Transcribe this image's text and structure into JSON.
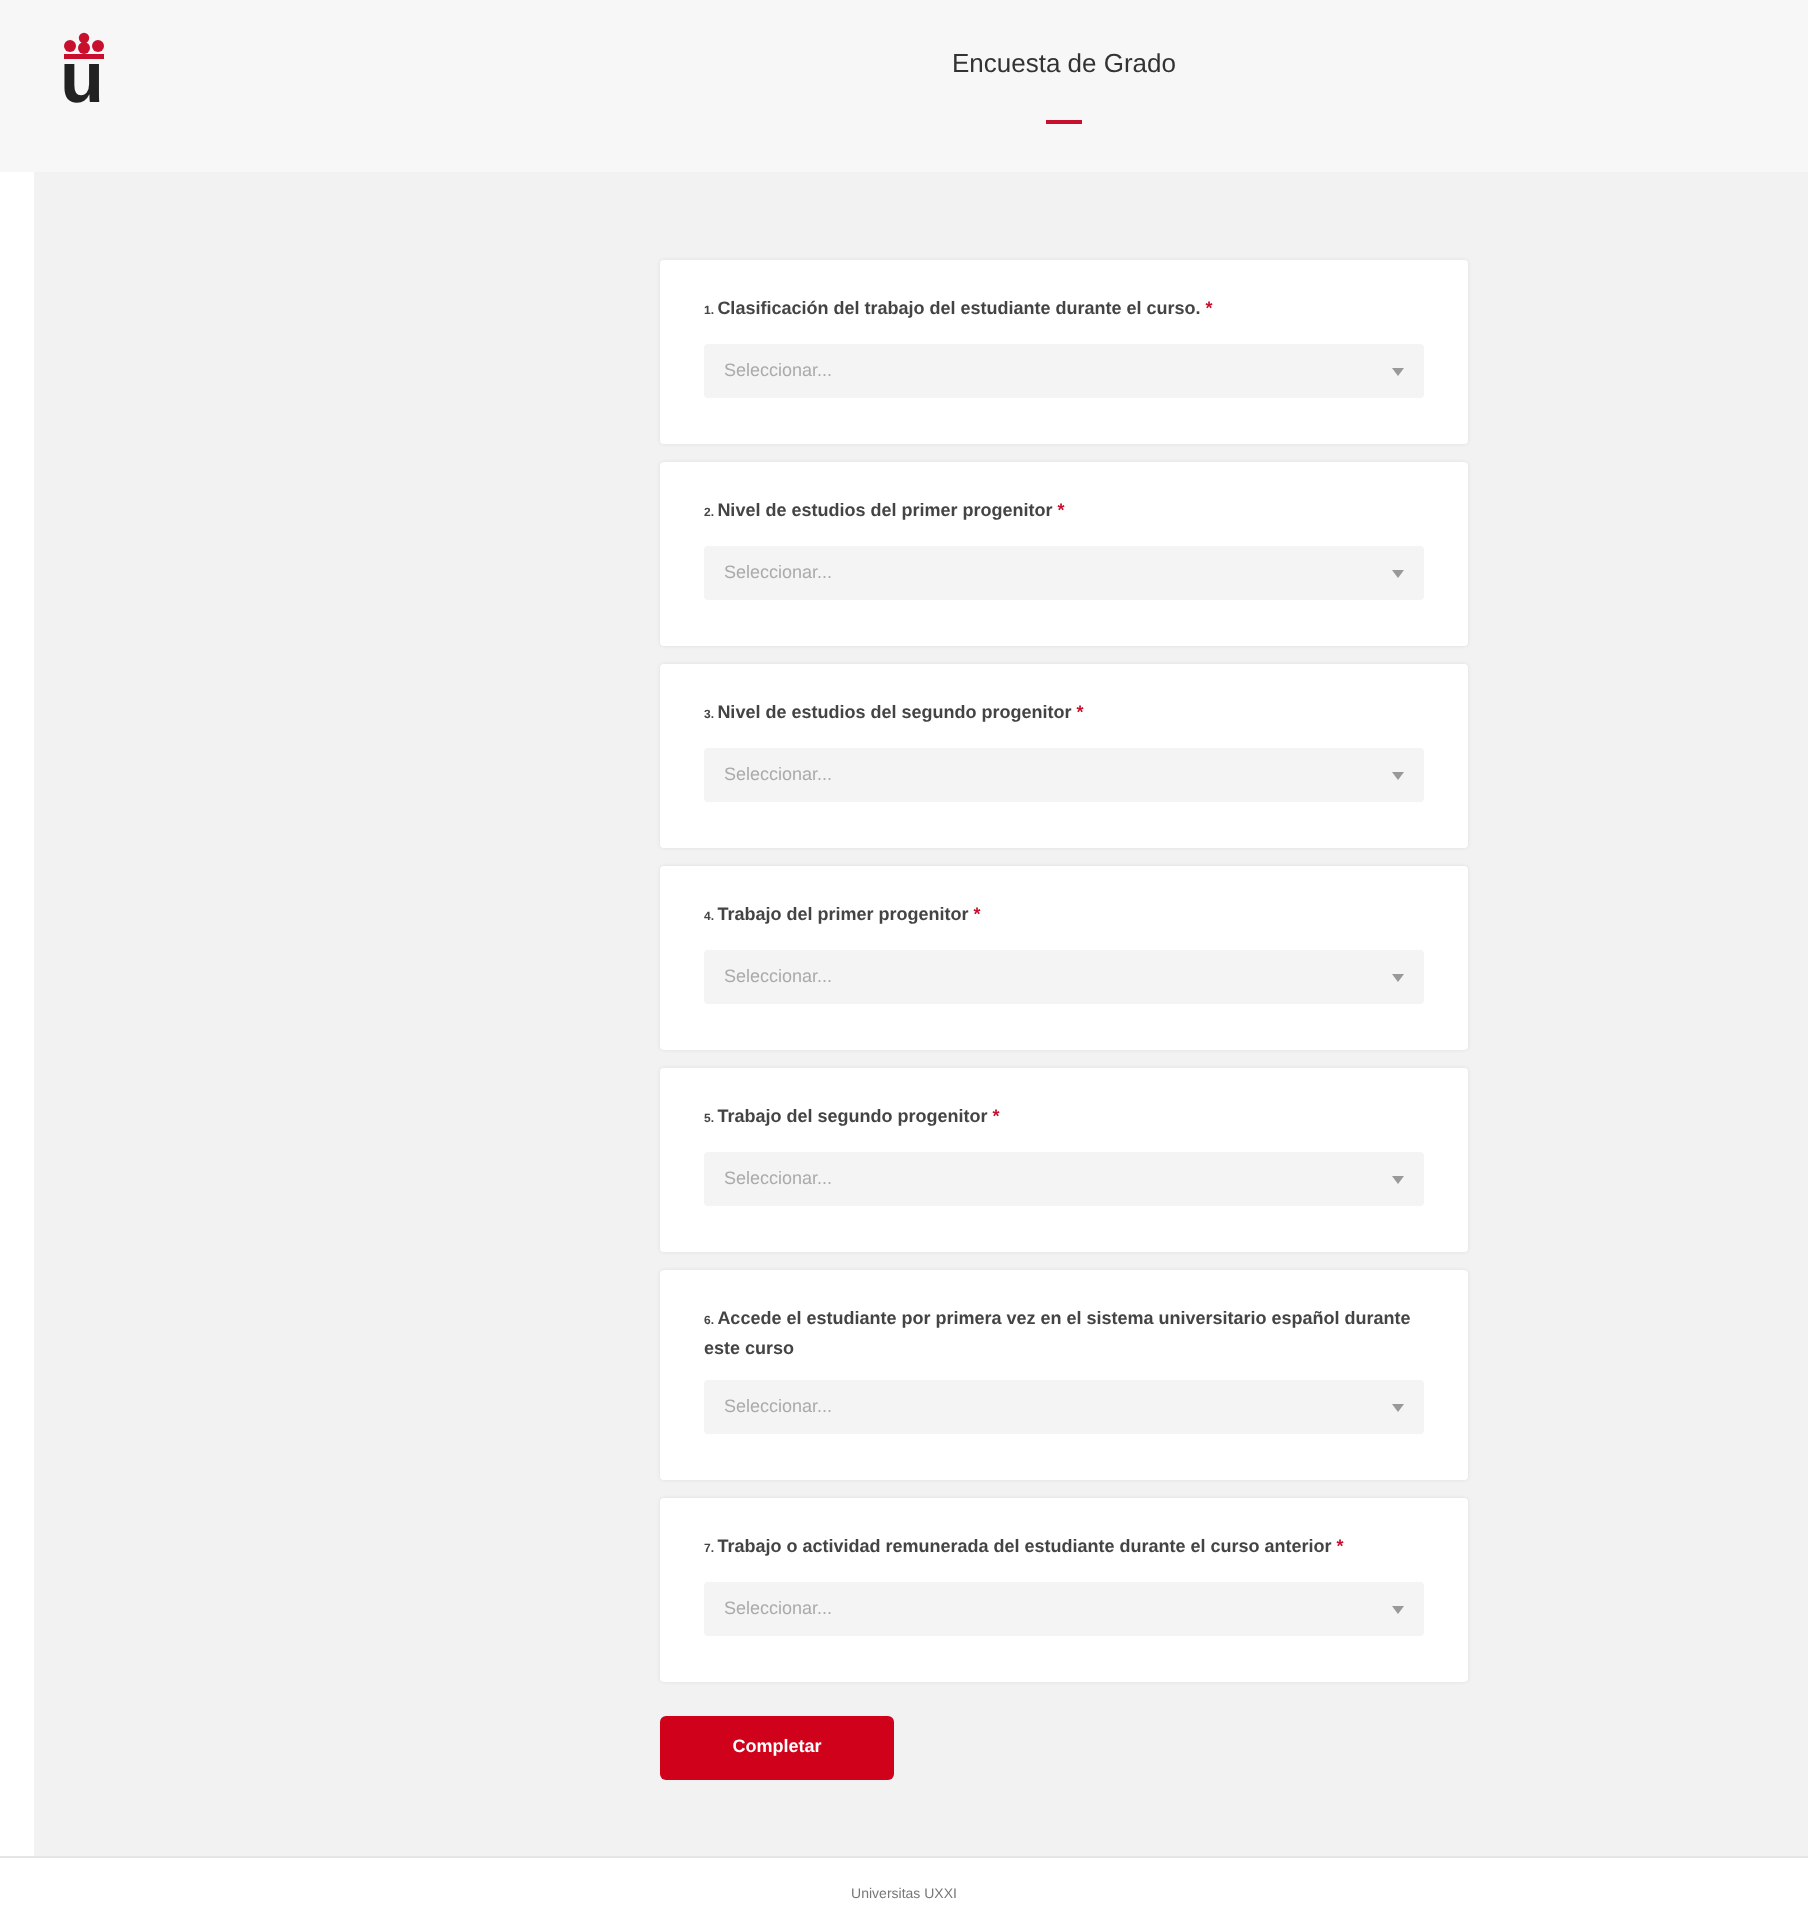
{
  "header": {
    "logo": "u",
    "title": "Encuesta de Grado"
  },
  "questions": [
    {
      "number": "1.",
      "label": "Clasificación del trabajo del estudiante durante el curso.",
      "required": true,
      "placeholder": "Seleccionar..."
    },
    {
      "number": "2.",
      "label": "Nivel de estudios del primer progenitor",
      "required": true,
      "placeholder": "Seleccionar..."
    },
    {
      "number": "3.",
      "label": "Nivel de estudios del segundo progenitor",
      "required": true,
      "placeholder": "Seleccionar..."
    },
    {
      "number": "4.",
      "label": "Trabajo del primer progenitor",
      "required": true,
      "placeholder": "Seleccionar..."
    },
    {
      "number": "5.",
      "label": "Trabajo del segundo progenitor",
      "required": true,
      "placeholder": "Seleccionar..."
    },
    {
      "number": "6.",
      "label": "Accede el estudiante por primera vez en el sistema universitario español durante este curso",
      "required": false,
      "placeholder": "Seleccionar..."
    },
    {
      "number": "7.",
      "label": "Trabajo o actividad remunerada del estudiante durante el curso anterior",
      "required": true,
      "placeholder": "Seleccionar..."
    }
  ],
  "required_mark": "*",
  "submit": "Completar",
  "footer": "Universitas UXXI"
}
